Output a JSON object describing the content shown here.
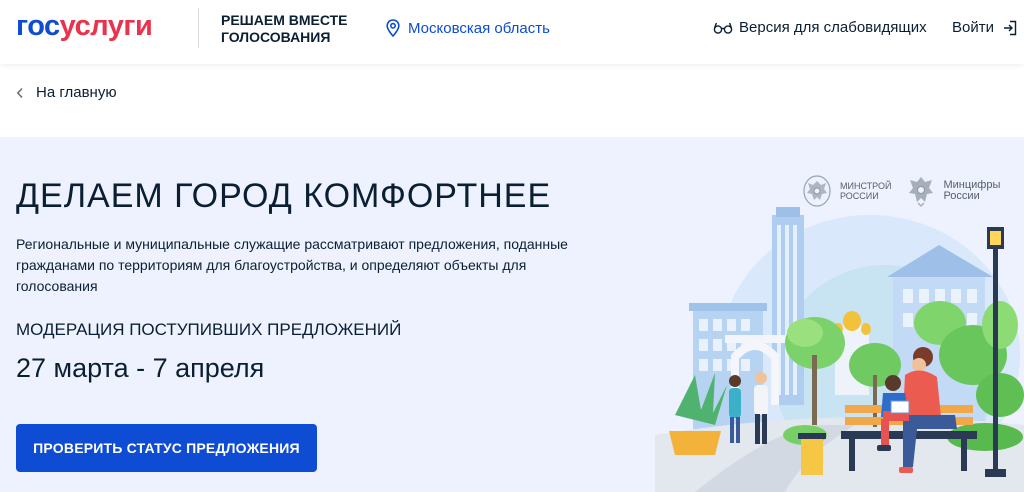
{
  "header": {
    "logo_part1": "гос",
    "logo_part2": "услуги",
    "slogan": "РЕШАЕМ ВМЕСТЕ ГОЛОСОВАНИЯ",
    "region": "Московская область",
    "accessible_version": "Версия для слабовидящих",
    "login": "Войти"
  },
  "breadcrumb": {
    "back_label": "На главную"
  },
  "hero": {
    "title": "ДЕЛАЕМ ГОРОД КОМФОРТНЕЕ",
    "description": "Региональные и муниципальные служащие рассматривают предложения, поданные гражданами по территориям для благоустройства, и определяют объекты для голосования",
    "stage": "МОДЕРАЦИЯ ПОСТУПИВШИХ ПРЕДЛОЖЕНИЙ",
    "dates": "27 марта - 7 апреля",
    "cta_label": "ПРОВЕРИТЬ СТАТУС ПРЕДЛОЖЕНИЯ"
  },
  "partners": [
    {
      "name_line1": "МИНСТРОЙ",
      "name_line2": "РОССИИ"
    },
    {
      "name_line1": "Минцифры",
      "name_line2": "России"
    }
  ],
  "icons": {
    "region": "location-pin-icon",
    "accessible": "glasses-icon",
    "login": "login-arrow-icon",
    "back": "chevron-left-icon"
  },
  "colors": {
    "brand_blue": "#0d4cd3",
    "brand_red": "#e9334d",
    "hero_bg": "#edf2fe",
    "text": "#0b1f33"
  }
}
